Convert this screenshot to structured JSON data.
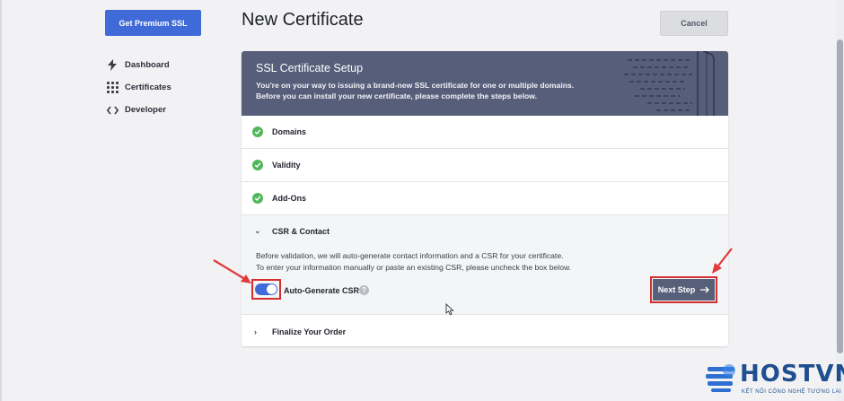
{
  "sidebar": {
    "premium_button": "Get Premium SSL",
    "items": [
      {
        "label": "Dashboard",
        "icon": "bolt-icon"
      },
      {
        "label": "Certificates",
        "icon": "grid-icon"
      },
      {
        "label": "Developer",
        "icon": "code-icon"
      }
    ]
  },
  "header": {
    "title": "New Certificate",
    "cancel_label": "Cancel"
  },
  "setup": {
    "title": "SSL Certificate Setup",
    "description_line1": "You're on your way to issuing a brand-new SSL certificate for one or multiple domains.",
    "description_line2": "Before you can install your new certificate, please complete the steps below."
  },
  "steps": {
    "completed": [
      "Domains",
      "Validity",
      "Add-Ons"
    ],
    "csr": {
      "title": "CSR & Contact",
      "desc_line1": "Before validation, we will auto-generate contact information and a CSR for your certificate.",
      "desc_line2": "To enter your information manually or paste an existing CSR, please uncheck the box below.",
      "toggle_label": "Auto-Generate CSR",
      "toggle_on": true,
      "next_label": "Next Step"
    },
    "finalize": "Finalize Your Order"
  },
  "watermark": {
    "brand": "HOSTVN",
    "tagline": "KẾT NỐI CÔNG NGHỆ TƯƠNG LAI"
  },
  "colors": {
    "primary": "#3f6ad8",
    "header_bg": "#565e79",
    "success": "#52b75b",
    "highlight": "#d32f2f"
  }
}
